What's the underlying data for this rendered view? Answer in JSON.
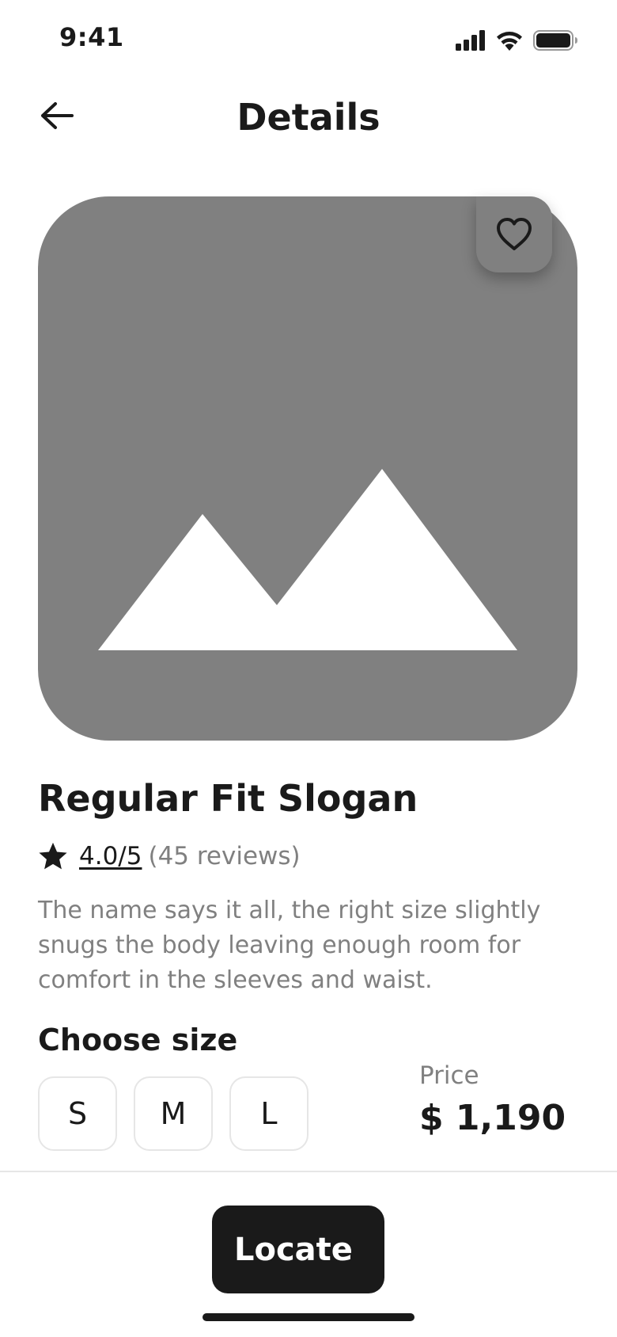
{
  "status_bar": {
    "time": "9:41",
    "icons": [
      "signal-icon",
      "wifi-icon",
      "battery-icon"
    ]
  },
  "header": {
    "back_icon": "arrow-left-icon",
    "title": "Details"
  },
  "product": {
    "image_icon": "image-placeholder-icon",
    "favorite_icon": "heart-icon",
    "name": "Regular Fit Slogan",
    "rating_icon": "star-icon",
    "rating_value": "4.0/5",
    "rating_count": "(45 reviews)",
    "description": "The name says it all, the right size slightly snugs the body leaving enough room for comfort in the sleeves and waist."
  },
  "size": {
    "label": "Choose size",
    "options": [
      "S",
      "M",
      "L"
    ]
  },
  "price": {
    "label": "Price",
    "value": "$ 1,190"
  },
  "actions": {
    "locate_label": "Locate"
  },
  "colors": {
    "primary": "#1a1a1a",
    "placeholder_gray": "#808080",
    "muted_text": "#808080",
    "border": "#e6e6e6",
    "background": "#ffffff"
  }
}
